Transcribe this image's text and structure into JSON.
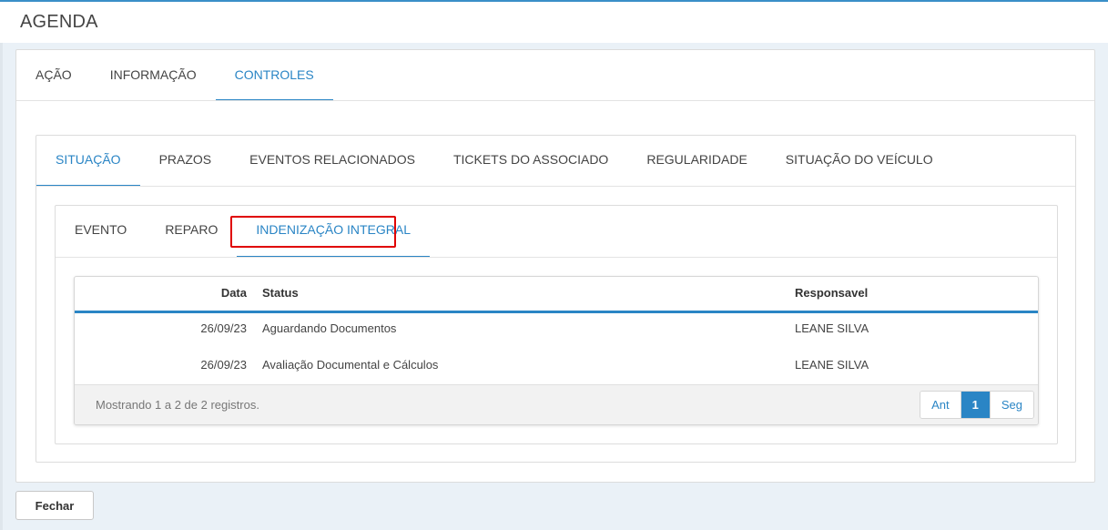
{
  "header": {
    "title": "AGENDA"
  },
  "tabs_level1": [
    {
      "label": "AÇÃO",
      "active": false
    },
    {
      "label": "INFORMAÇÃO",
      "active": false
    },
    {
      "label": "CONTROLES",
      "active": true
    }
  ],
  "tabs_level2": [
    {
      "label": "SITUAÇÃO",
      "active": true
    },
    {
      "label": "PRAZOS",
      "active": false
    },
    {
      "label": "EVENTOS RELACIONADOS",
      "active": false
    },
    {
      "label": "TICKETS DO ASSOCIADO",
      "active": false
    },
    {
      "label": "REGULARIDADE",
      "active": false
    },
    {
      "label": "SITUAÇÃO DO VEÍCULO",
      "active": false
    }
  ],
  "tabs_level3": [
    {
      "label": "EVENTO",
      "active": false
    },
    {
      "label": "REPARO",
      "active": false
    },
    {
      "label": "INDENIZAÇÃO INTEGRAL",
      "active": true
    }
  ],
  "table": {
    "columns": {
      "date": "Data",
      "status": "Status",
      "responsible": "Responsavel"
    },
    "rows": [
      {
        "date": "26/09/23",
        "status": "Aguardando Documentos",
        "responsible": "LEANE SILVA"
      },
      {
        "date": "26/09/23",
        "status": "Avaliação Documental e Cálculos",
        "responsible": "LEANE SILVA"
      }
    ],
    "footer_info": "Mostrando 1 a 2 de 2 registros.",
    "pagination": {
      "prev": "Ant",
      "current": "1",
      "next": "Seg"
    }
  },
  "actions": {
    "close_label": "Fechar"
  },
  "colors": {
    "accent": "#2a85c5",
    "highlight": "#e00000"
  }
}
